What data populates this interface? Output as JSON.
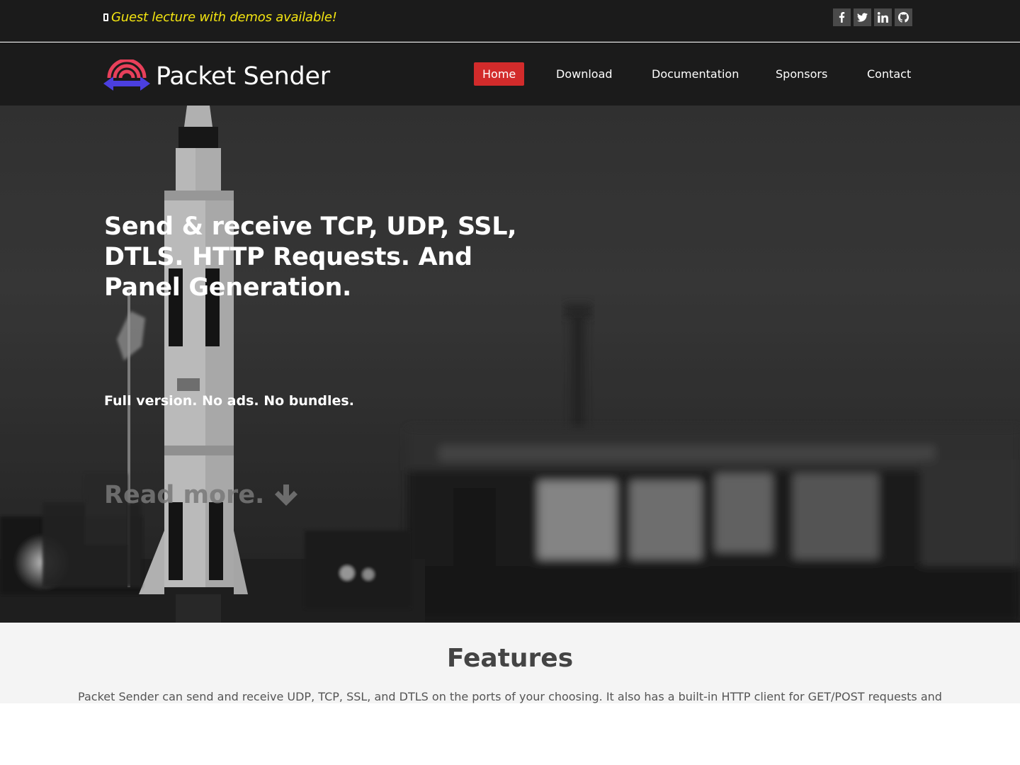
{
  "topbar": {
    "announcement": "Guest lecture with demos available!",
    "icons": [
      "phone-icon",
      "facebook-icon",
      "twitter-icon",
      "linkedin-icon",
      "github-icon"
    ]
  },
  "brand": {
    "name": "Packet Sender",
    "logo_colors": {
      "arcs": "#e8405a",
      "arrow": "#4b3fe0"
    }
  },
  "nav": {
    "items": [
      {
        "label": "Home",
        "active": true
      },
      {
        "label": "Download",
        "active": false
      },
      {
        "label": "Documentation",
        "active": false
      },
      {
        "label": "Sponsors",
        "active": false
      },
      {
        "label": "Contact",
        "active": false
      }
    ]
  },
  "hero": {
    "title": "Send & receive TCP, UDP, SSL, DTLS. HTTP Requests. And Panel Generation.",
    "subtitle": "Full version. No ads. No bundles.",
    "read_more": "Read more."
  },
  "features": {
    "title": "Features",
    "text": "Packet Sender can send and receive UDP, TCP, SSL, and DTLS on the ports of your choosing. It also has a built-in HTTP client for GET/POST requests and"
  },
  "colors": {
    "bar_bg": "#1b1b1b",
    "accent": "#d22b2b",
    "announcement": "#f4e511",
    "features_bg": "#f4f4f4"
  }
}
